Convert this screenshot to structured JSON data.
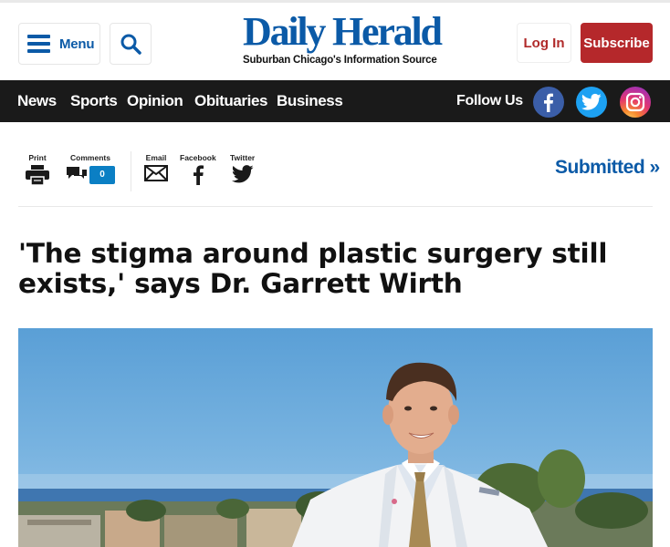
{
  "header": {
    "menu_label": "Menu",
    "logo_name": "Daily Herald",
    "logo_tagline": "Suburban Chicago's Information Source",
    "login_label": "Log In",
    "subscribe_label": "Subscribe"
  },
  "nav": {
    "items": [
      {
        "label": "News"
      },
      {
        "label": "Sports"
      },
      {
        "label": "Opinion"
      },
      {
        "label": "Obituaries"
      },
      {
        "label": "Business"
      }
    ],
    "follow_label": "Follow Us",
    "social": [
      "facebook-icon",
      "twitter-icon",
      "instagram-icon"
    ]
  },
  "share": {
    "print_label": "Print",
    "comments_label": "Comments",
    "comments_count": "0",
    "email_label": "Email",
    "facebook_label": "Facebook",
    "twitter_label": "Twitter",
    "submitted_label": "Submitted »"
  },
  "article": {
    "headline": "'The stigma around plastic surgery still exists,' says Dr. Garrett Wirth"
  },
  "colors": {
    "brand_blue": "#0b5aa7",
    "subscribe_red": "#b5282b",
    "nav_bg": "#1a1a1a",
    "comment_badge": "#0b7fc4"
  }
}
